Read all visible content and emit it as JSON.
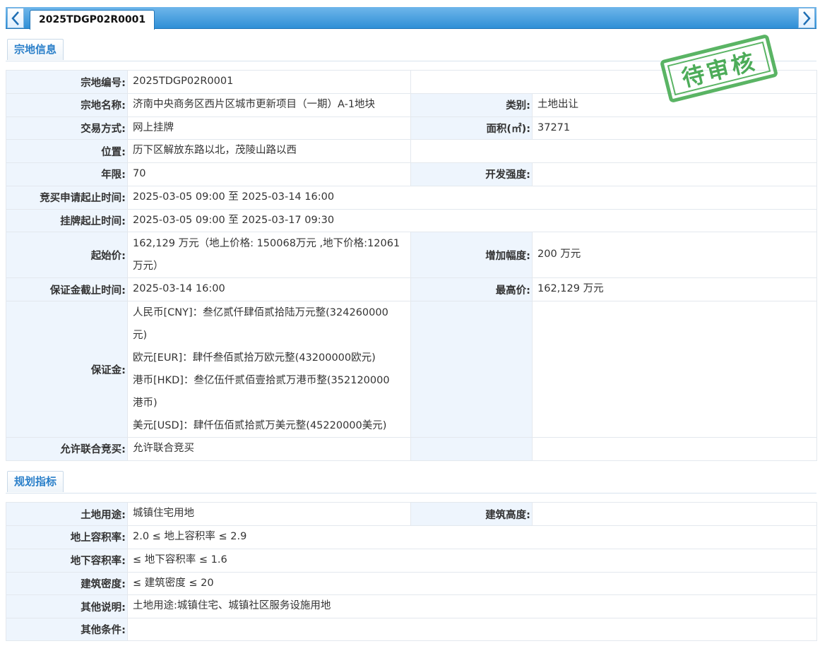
{
  "tab": {
    "title": "2025TDGP02R0001"
  },
  "sections": {
    "parcel_title": "宗地信息",
    "planning_title": "规划指标"
  },
  "stamp_text": "待审核",
  "parcel": {
    "code_label": "宗地编号:",
    "code": "2025TDGP02R0001",
    "name_label": "宗地名称:",
    "name": "济南中央商务区西片区城市更新项目（一期）A-1地块",
    "category_label": "类别:",
    "category": "土地出让",
    "trade_label": "交易方式:",
    "trade": "网上挂牌",
    "area_label": "面积(㎡):",
    "area": "37271",
    "location_label": "位置:",
    "location": "历下区解放东路以北，茂陵山路以西",
    "term_label": "年限:",
    "term": "70",
    "intensity_label": "开发强度:",
    "intensity": "",
    "apply_time_label": "竞买申请起止时间:",
    "apply_time": "2025-03-05 09:00 至 2025-03-14 16:00",
    "list_time_label": "挂牌起止时间:",
    "list_time": "2025-03-05 09:00 至 2025-03-17 09:30",
    "start_price_label": "起始价:",
    "start_price_line1": "162,129 万元（地上价格: 150068万元 ,地下价格:12061",
    "start_price_line2": "万元）",
    "increment_label": "增加幅度:",
    "increment": "200 万元",
    "deposit_deadline_label": "保证金截止时间:",
    "deposit_deadline": "2025-03-14 16:00",
    "max_price_label": "最高价:",
    "max_price": "162,129 万元",
    "deposit_label": "保证金:",
    "deposit_lines": [
      "人民币[CNY]：叁亿贰仟肆佰贰拾陆万元整(324260000",
      "元)",
      "欧元[EUR]：肆仟叁佰贰拾万欧元整(43200000欧元)",
      "港币[HKD]：叁亿伍仟贰佰壹拾贰万港币整(352120000",
      "港币)",
      "美元[USD]：肆仟伍佰贰拾贰万美元整(45220000美元)"
    ],
    "joint_label": "允许联合竞买:",
    "joint": "允许联合竞买"
  },
  "planning": {
    "use_label": "土地用途:",
    "use": "城镇住宅用地",
    "height_label": "建筑高度:",
    "height": "",
    "far_above_label": "地上容积率:",
    "far_above": "2.0 ≤ 地上容积率 ≤ 2.9",
    "far_below_label": "地下容积率:",
    "far_below": "≤ 地下容积率 ≤ 1.6",
    "density_label": "建筑密度:",
    "density": "≤ 建筑密度 ≤ 20",
    "notes_label": "其他说明:",
    "notes": "土地用途:城镇住宅、城镇社区服务设施用地",
    "other_label": "其他条件:",
    "other": ""
  },
  "colors": {
    "accent": "#2f8fd6",
    "label_bg": "#eef5fd",
    "stamp": "#3ea84a"
  },
  "icons": {
    "prev": "chevron-left-icon",
    "next": "chevron-right-icon"
  }
}
